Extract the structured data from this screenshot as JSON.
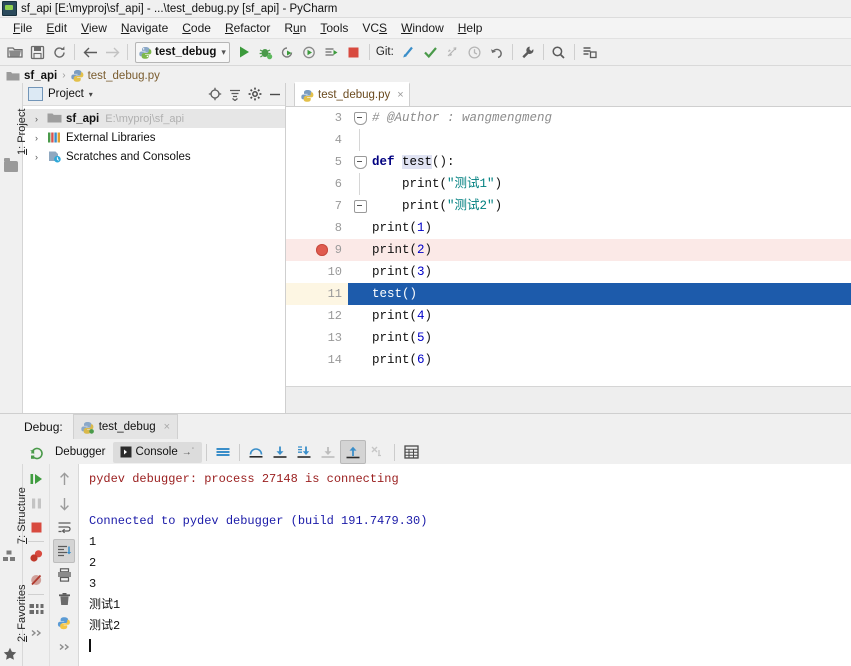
{
  "window": {
    "title": "sf_api [E:\\myproj\\sf_api] - ...\\test_debug.py [sf_api] - PyCharm",
    "app_icon": "pycharm-icon"
  },
  "menubar": {
    "items": [
      {
        "label": "File",
        "mnemonic": "F"
      },
      {
        "label": "Edit",
        "mnemonic": "E"
      },
      {
        "label": "View",
        "mnemonic": "V"
      },
      {
        "label": "Navigate",
        "mnemonic": "N"
      },
      {
        "label": "Code",
        "mnemonic": "C"
      },
      {
        "label": "Refactor",
        "mnemonic": "R"
      },
      {
        "label": "Run",
        "mnemonic": "u"
      },
      {
        "label": "Tools",
        "mnemonic": "T"
      },
      {
        "label": "VCS",
        "mnemonic": "S"
      },
      {
        "label": "Window",
        "mnemonic": "W"
      },
      {
        "label": "Help",
        "mnemonic": "H"
      }
    ]
  },
  "toolbar": {
    "left_buttons": [
      "open-folder-icon",
      "save-all-icon",
      "sync-refresh-icon"
    ],
    "nav_back": "arrow-back-icon",
    "nav_forward": "arrow-forward-icon",
    "run_config": {
      "name": "test_debug",
      "icon": "python-config-icon",
      "dropdown": "▾"
    },
    "run_buttons": [
      "run-icon",
      "debug-icon",
      "run-coverage-icon",
      "profile-icon",
      "run-with-console-icon",
      "stop-icon"
    ],
    "git_label": "Git:",
    "git_buttons": [
      "update-project-icon",
      "commit-icon",
      "push-icon",
      "history-icon",
      "rollback-icon"
    ],
    "right_buttons": [
      "settings-wrench-icon",
      "search-everywhere-icon",
      "layout-icon"
    ]
  },
  "breadcrumb": {
    "root": "sf_api",
    "separator": "›",
    "file": "test_debug.py"
  },
  "left_tool_strip": {
    "project_tab": "1: Project",
    "project_tab_number": "1:",
    "project_tab_name": "Project"
  },
  "project_panel": {
    "title": "Project",
    "caret": "▾",
    "header_buttons": [
      "locate-target-icon",
      "collapse-all-icon",
      "settings-gear-icon",
      "hide-minimize-icon"
    ],
    "tree": [
      {
        "label": "sf_api",
        "path": "E:\\myproj\\sf_api",
        "icon": "folder-icon",
        "bold": true,
        "selected": true,
        "arrow": "›"
      },
      {
        "label": "External Libraries",
        "path": "",
        "icon": "libraries-icon",
        "bold": false,
        "selected": false,
        "arrow": "›"
      },
      {
        "label": "Scratches and Consoles",
        "path": "",
        "icon": "scratches-icon",
        "bold": false,
        "selected": false,
        "arrow": "›"
      }
    ]
  },
  "editor": {
    "tab": {
      "label": "test_debug.py",
      "icon": "python-file-icon",
      "close": "×"
    },
    "lines": [
      {
        "num": "3",
        "indent": 0,
        "fold": "open",
        "kind": "comment",
        "text": "# @Author : wangmengmeng"
      },
      {
        "num": "4",
        "indent": 0,
        "fold": "",
        "kind": "blank",
        "text": ""
      },
      {
        "num": "5",
        "indent": 0,
        "fold": "open",
        "kind": "def",
        "text": "def test():"
      },
      {
        "num": "6",
        "indent": 1,
        "fold": "",
        "kind": "print_str",
        "text": "    print(\"测试1\")"
      },
      {
        "num": "7",
        "indent": 1,
        "fold": "close",
        "kind": "print_str",
        "text": "    print(\"测试2\")"
      },
      {
        "num": "8",
        "indent": 0,
        "fold": "",
        "kind": "print_num",
        "text": "print(1)"
      },
      {
        "num": "9",
        "indent": 0,
        "fold": "",
        "kind": "print_num",
        "text": "print(2)",
        "breakpoint": true
      },
      {
        "num": "10",
        "indent": 0,
        "fold": "",
        "kind": "print_num",
        "text": "print(3)"
      },
      {
        "num": "11",
        "indent": 0,
        "fold": "",
        "kind": "call",
        "text": "test()",
        "current": true
      },
      {
        "num": "12",
        "indent": 0,
        "fold": "",
        "kind": "print_num",
        "text": "print(4)"
      },
      {
        "num": "13",
        "indent": 0,
        "fold": "",
        "kind": "print_num",
        "text": "print(5)"
      },
      {
        "num": "14",
        "indent": 0,
        "fold": "",
        "kind": "print_num",
        "text": "print(6)"
      }
    ]
  },
  "debug_window": {
    "label": "Debug:",
    "tab": {
      "label": "test_debug",
      "icon": "python-run-icon",
      "close": "×"
    },
    "rerun_icon": "rerun-icon",
    "subtabs": [
      {
        "label": "Debugger",
        "active": false,
        "icon": ""
      },
      {
        "label": "Console",
        "active": true,
        "icon": "console-icon",
        "pin": "→˙"
      }
    ],
    "toolbar_buttons": [
      "show-all-frames-icon",
      "step-over-icon",
      "step-into-icon",
      "force-step-into-icon",
      "step-out-disabled-icon",
      "run-to-cursor-icon",
      "evaluate-expression-icon",
      "calculator-icon"
    ],
    "side_icons_col1": [
      "resume-program-icon",
      "pause-program-icon",
      "stop-icon",
      "view-breakpoints-icon",
      "mute-breakpoints-icon",
      "settings-layout-icon"
    ],
    "side_icons_col2": [
      "up-stack-icon",
      "down-stack-icon",
      "soft-wrap-icon",
      "scroll-to-end-icon",
      "print-icon",
      "trash-icon",
      "python-console-icon"
    ],
    "vertical_tabs": [
      {
        "label": "7: Structure",
        "number": "7:",
        "name": "Structure"
      },
      {
        "label": "2: Favorites",
        "number": "2:",
        "name": "Favorites"
      }
    ],
    "console_lines": [
      {
        "text": "pydev debugger: process 27148 is connecting",
        "style": "err"
      },
      {
        "text": "",
        "style": "out"
      },
      {
        "text": "Connected to pydev debugger (build 191.7479.30)",
        "style": "info"
      },
      {
        "text": "1",
        "style": "out"
      },
      {
        "text": "2",
        "style": "out"
      },
      {
        "text": "3",
        "style": "out"
      },
      {
        "text": "测试1",
        "style": "out"
      },
      {
        "text": "测试2",
        "style": "out"
      }
    ]
  },
  "colors": {
    "chrome": "#f0f0f0",
    "editor_bg": "#ffffff",
    "breakpoint_line": "#fbe9e7",
    "current_line": "#1d5bab",
    "current_gutter": "#fdf6e3",
    "breakpoint_dot": "#e05b4f",
    "keyword": "#000080",
    "string": "#008080",
    "number": "#0000c8",
    "comment": "#8c8c8c",
    "console_error": "#9b2020",
    "console_info": "#1a1aa8",
    "run_green": "#3c9a3c",
    "stop_red": "#d84a3f"
  }
}
